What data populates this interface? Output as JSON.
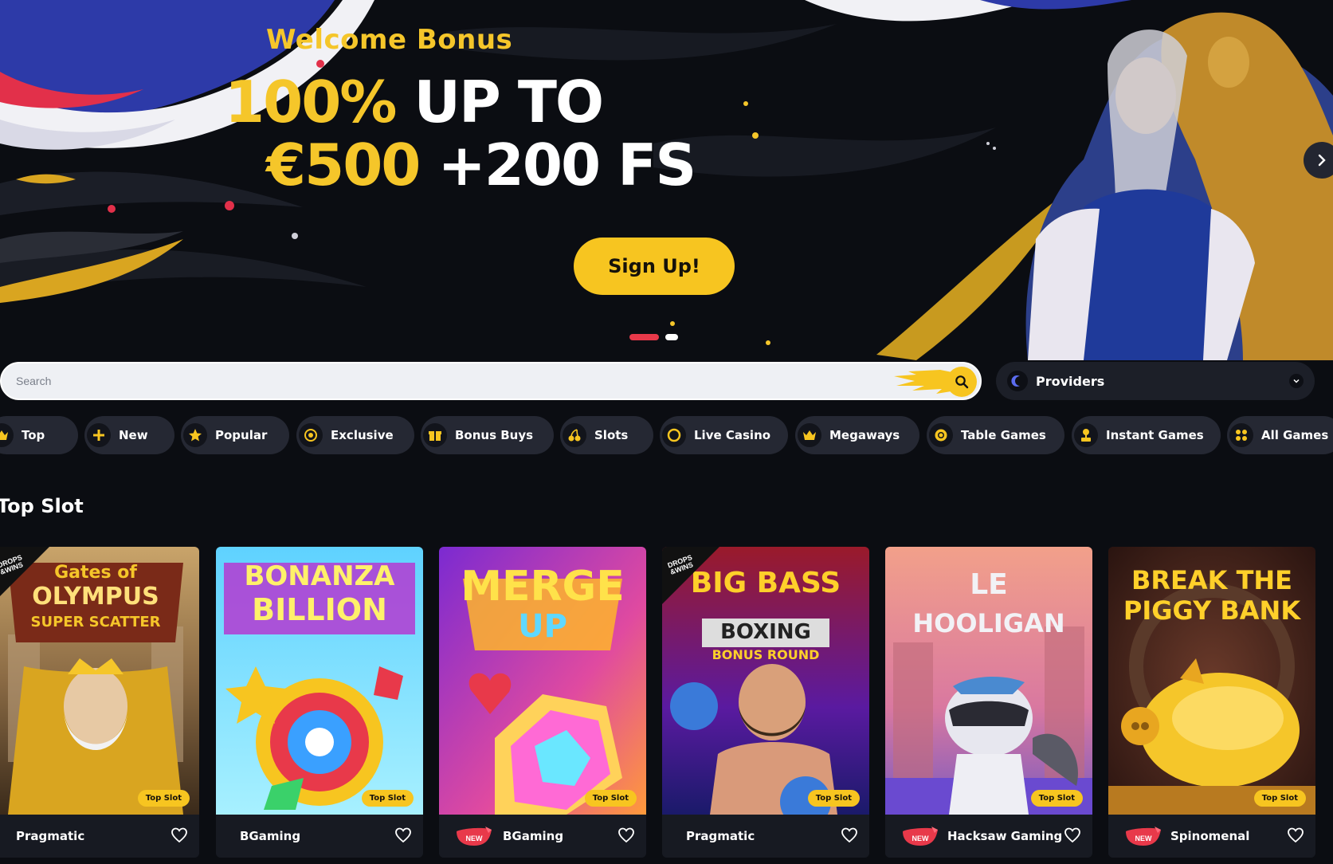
{
  "hero": {
    "welcome": "Welcome Bonus",
    "line1_gold": "100%",
    "line1_white": "UP TO",
    "line2_gold": "€500",
    "line2_white": "+200 FS",
    "cta": "Sign Up!",
    "slides": 2,
    "active_slide": 1
  },
  "search": {
    "placeholder": "Search"
  },
  "providers": {
    "label": "Providers"
  },
  "categories": [
    {
      "label": "Top",
      "icon": "crown-icon"
    },
    {
      "label": "New",
      "icon": "plus-icon"
    },
    {
      "label": "Popular",
      "icon": "star-icon"
    },
    {
      "label": "Exclusive",
      "icon": "target-icon"
    },
    {
      "label": "Bonus Buys",
      "icon": "gift-icon"
    },
    {
      "label": "Slots",
      "icon": "cherry-icon"
    },
    {
      "label": "Live Casino",
      "icon": "live-icon"
    },
    {
      "label": "Megaways",
      "icon": "crown-icon"
    },
    {
      "label": "Table Games",
      "icon": "chip-icon"
    },
    {
      "label": "Instant Games",
      "icon": "joystick-icon"
    },
    {
      "label": "All Games",
      "icon": "grid-icon"
    }
  ],
  "section": {
    "title": "Top Slot"
  },
  "games": [
    {
      "title_lines": [
        "Gates of",
        "OLYMPUS",
        "SUPER SCATTER"
      ],
      "provider": "Pragmatic",
      "badge": "Top Slot",
      "is_new": false,
      "drops_wins": true,
      "theme": "olympus"
    },
    {
      "title_lines": [
        "BONANZA",
        "BILLION"
      ],
      "provider": "BGaming",
      "badge": "Top Slot",
      "is_new": false,
      "drops_wins": false,
      "theme": "bonanza"
    },
    {
      "title_lines": [
        "MERGE",
        "UP"
      ],
      "provider": "BGaming",
      "badge": "Top Slot",
      "is_new": true,
      "drops_wins": false,
      "theme": "merge"
    },
    {
      "title_lines": [
        "BIG BASS",
        "BOXING",
        "BONUS ROUND"
      ],
      "provider": "Pragmatic",
      "badge": "Top Slot",
      "is_new": false,
      "drops_wins": true,
      "theme": "bigbass"
    },
    {
      "title_lines": [
        "LE",
        "HOOLIGAN"
      ],
      "provider": "Hacksaw Gaming",
      "badge": "Top Slot",
      "is_new": true,
      "drops_wins": false,
      "theme": "hooligan"
    },
    {
      "title_lines": [
        "BREAK THE",
        "PIGGY BANK"
      ],
      "provider": "Spinomenal",
      "badge": "Top Slot",
      "is_new": true,
      "drops_wins": false,
      "theme": "piggy"
    }
  ],
  "labels": {
    "new_badge": "NEW",
    "drops_line1": "DROPS",
    "drops_line2": "&WINS"
  },
  "colors": {
    "accent": "#f7c520",
    "background": "#0b0d12",
    "chip": "#252833",
    "card": "#171a22",
    "new_badge": "#e8394a"
  }
}
